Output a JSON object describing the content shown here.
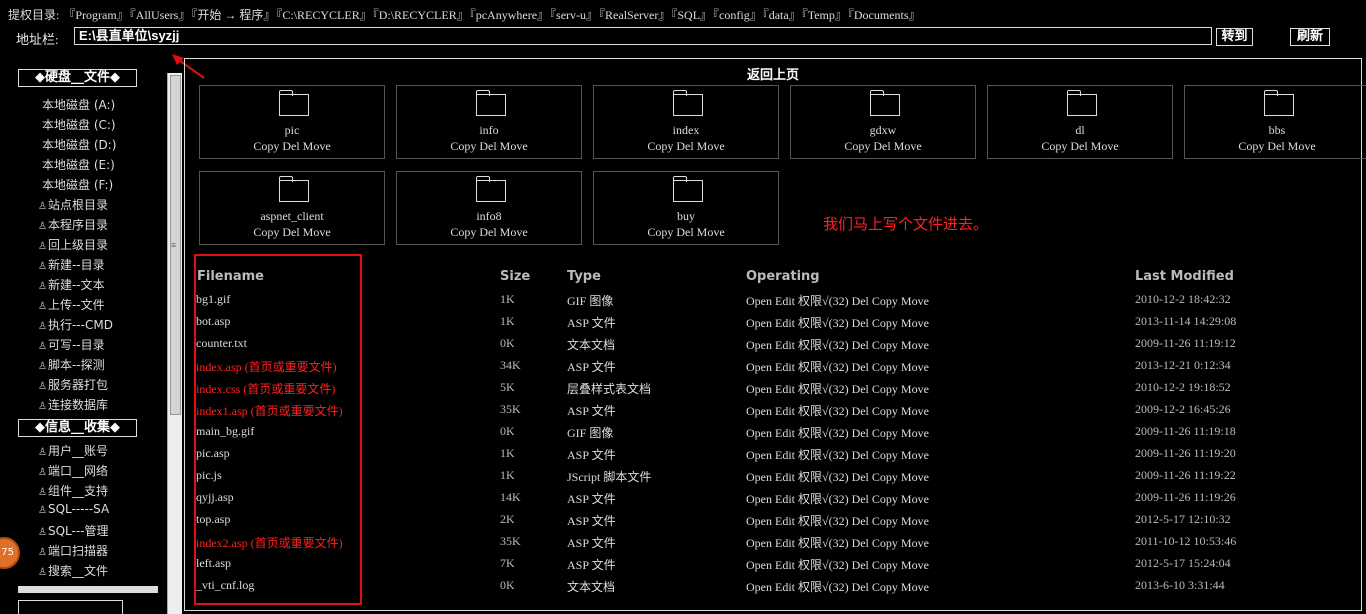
{
  "crumbs": {
    "label": "提权目录:",
    "items": [
      "『Program』",
      "『AllUsers』",
      "『开始 → 程序』",
      "『C:\\RECYCLER』",
      "『D:\\RECYCLER』",
      "『pcAnywhere』",
      "『serv-u』",
      "『RealServer』",
      "『SQL』",
      "『config』",
      "『data』",
      "『Temp』",
      "『Documents』"
    ]
  },
  "address": {
    "label": "地址栏:",
    "value": "E:\\县直单位\\syzjj",
    "go": "转到",
    "refresh": "刷新"
  },
  "sidebar": {
    "disk_header": "◆硬盘__文件◆",
    "disks": [
      "本地磁盘 (A:)",
      "本地磁盘 (C:)",
      "本地磁盘 (D:)",
      "本地磁盘 (E:)",
      "本地磁盘 (F:)"
    ],
    "tools": [
      "站点根目录",
      "本程序目录",
      "回上级目录",
      "新建--目录",
      "新建--文本",
      "上传--文件",
      "执行---CMD",
      "可写--目录",
      "脚本--探测",
      "服务器打包",
      "连接数据库"
    ],
    "info_header": "◆信息__收集◆",
    "info_tools": [
      "用户__账号",
      "端口__网络",
      "组件__支持",
      "SQL-----SA",
      "SQL---管理",
      "端口扫描器",
      "搜索__文件"
    ],
    "badge": "75"
  },
  "main": {
    "back": "返回上页",
    "folder_ops": "Copy Del Move",
    "folders": [
      "pic",
      "info",
      "index",
      "gdxw",
      "dl",
      "bbs",
      "aspnet_client",
      "info8",
      "buy"
    ],
    "note": "我们马上写个文件进去。",
    "headers": {
      "filename": "Filename",
      "size": "Size",
      "type": "Type",
      "operating": "Operating",
      "modified": "Last Modified"
    },
    "ops": "Open Edit 权限√(32) Del Copy Move",
    "files": [
      {
        "name": "bg1.gif",
        "size": "1K",
        "type": "GIF 图像",
        "date": "2010-12-2 18:42:32",
        "important": false
      },
      {
        "name": "bot.asp",
        "size": "1K",
        "type": "ASP 文件",
        "date": "2013-11-14 14:29:08",
        "important": false
      },
      {
        "name": "counter.txt",
        "size": "0K",
        "type": "文本文档",
        "date": "2009-11-26 11:19:12",
        "important": false
      },
      {
        "name": "index.asp (首页或重要文件)",
        "size": "34K",
        "type": "ASP 文件",
        "date": "2013-12-21 0:12:34",
        "important": true
      },
      {
        "name": "index.css (首页或重要文件)",
        "size": "5K",
        "type": "层叠样式表文档",
        "date": "2010-12-2 19:18:52",
        "important": true
      },
      {
        "name": "index1.asp (首页或重要文件)",
        "size": "35K",
        "type": "ASP 文件",
        "date": "2009-12-2 16:45:26",
        "important": true
      },
      {
        "name": "main_bg.gif",
        "size": "0K",
        "type": "GIF 图像",
        "date": "2009-11-26 11:19:18",
        "important": false
      },
      {
        "name": "pic.asp",
        "size": "1K",
        "type": "ASP 文件",
        "date": "2009-11-26 11:19:20",
        "important": false
      },
      {
        "name": "pic.js",
        "size": "1K",
        "type": "JScript 脚本文件",
        "date": "2009-11-26 11:19:22",
        "important": false
      },
      {
        "name": "qyjj.asp",
        "size": "14K",
        "type": "ASP 文件",
        "date": "2009-11-26 11:19:26",
        "important": false
      },
      {
        "name": "top.asp",
        "size": "2K",
        "type": "ASP 文件",
        "date": "2012-5-17 12:10:32",
        "important": false
      },
      {
        "name": "index2.asp (首页或重要文件)",
        "size": "35K",
        "type": "ASP 文件",
        "date": "2011-10-12 10:53:46",
        "important": true
      },
      {
        "name": "left.asp",
        "size": "7K",
        "type": "ASP 文件",
        "date": "2012-5-17 15:24:04",
        "important": false
      },
      {
        "name": "_vti_cnf.log",
        "size": "0K",
        "type": "文本文档",
        "date": "2013-6-10 3:31:44",
        "important": false
      }
    ]
  },
  "colors": {
    "accent_red": "#ff2020",
    "annotation_box": "#e01010"
  }
}
